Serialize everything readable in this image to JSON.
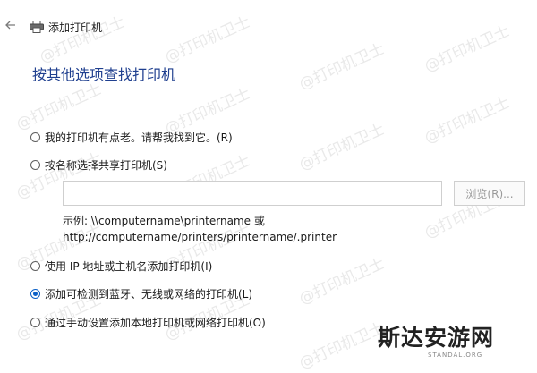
{
  "titlebar": {
    "title": "添加打印机"
  },
  "heading": "按其他选项查找打印机",
  "options": [
    {
      "label": "我的打印机有点老。请帮我找到它。(R)",
      "selected": false
    },
    {
      "label": "按名称选择共享打印机(S)",
      "selected": false
    },
    {
      "label": "使用 IP 地址或主机名添加打印机(I)",
      "selected": false
    },
    {
      "label": "添加可检测到蓝牙、无线或网络的打印机(L)",
      "selected": true
    },
    {
      "label": "通过手动设置添加本地打印机或网络打印机(O)",
      "selected": false
    }
  ],
  "shared_printer": {
    "input_value": "",
    "browse_label": "浏览(R)...",
    "example_line1": "示例: \\\\computername\\printername 或",
    "example_line2": "http://computername/printers/printername/.printer"
  },
  "watermark": {
    "text": "@打印机卫士"
  },
  "brand": {
    "name": "斯达安游网",
    "url": "STANDAL.ORG"
  },
  "colors": {
    "accent": "#0a60c7",
    "heading": "#1f3f8f"
  }
}
